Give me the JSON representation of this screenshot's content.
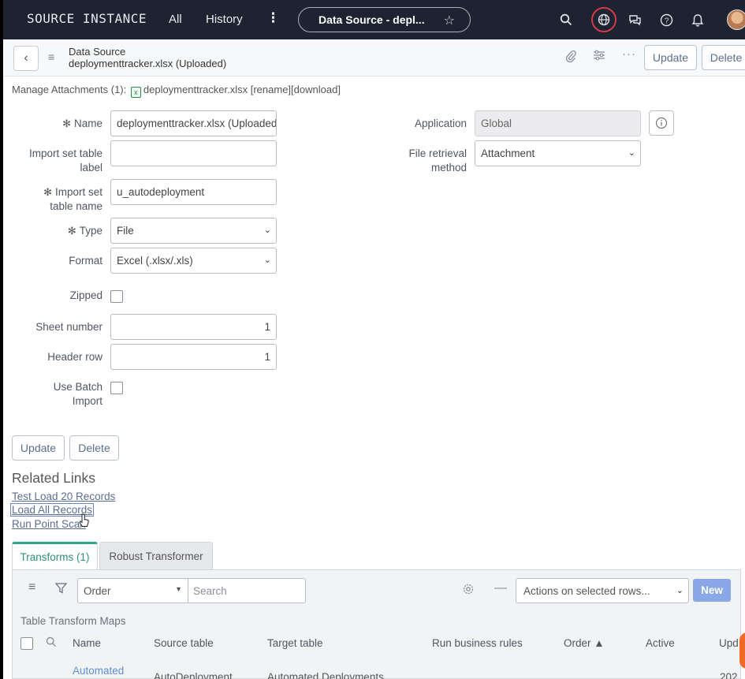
{
  "topnav": {
    "brand": "SOURCE INSTANCE",
    "all": "All",
    "history": "History",
    "more": "⋮",
    "context_title": "Data Source - depl...",
    "icons": [
      "search-icon",
      "globe-icon",
      "chat-icon",
      "help-icon",
      "bell-icon",
      "avatar"
    ]
  },
  "header": {
    "title_line1": "Data Source",
    "title_line2": "deploymenttracker.xlsx (Uploaded)",
    "update_label": "Update",
    "delete_label": "Delete"
  },
  "attachments": {
    "prefix": "Manage Attachments (1):",
    "filename": "deploymenttracker.xlsx",
    "rename": "[rename]",
    "download": "[download]"
  },
  "form": {
    "name_label": "Name",
    "name_value": "deploymenttracker.xlsx (Uploaded)",
    "import_label_line1": "Import set table",
    "import_label_line2": "label",
    "import_label_value": "",
    "import_name_line1": "Import set",
    "import_name_line2": "table name",
    "import_name_value": "u_autodeployment",
    "type_label": "Type",
    "type_value": "File",
    "format_label": "Format",
    "format_value": "Excel (.xlsx/.xls)",
    "zipped_label": "Zipped",
    "sheet_label": "Sheet number",
    "sheet_value": "1",
    "header_row_label": "Header row",
    "header_row_value": "1",
    "batch_line1": "Use Batch",
    "batch_line2": "Import",
    "application_label": "Application",
    "application_value": "Global",
    "retrieval_line1": "File retrieval",
    "retrieval_line2": "method",
    "retrieval_value": "Attachment"
  },
  "bottom_buttons": {
    "update": "Update",
    "delete": "Delete"
  },
  "related_links": {
    "title": "Related Links",
    "links": [
      "Test Load 20 Records",
      "Load All Records",
      "Run Point Scan"
    ]
  },
  "tabs": [
    {
      "label": "Transforms (1)",
      "active": true
    },
    {
      "label": "Robust Transformer",
      "active": false
    }
  ],
  "list": {
    "order_select": "Order",
    "search_placeholder": "Search",
    "actions_select": "Actions on selected rows...",
    "new_label": "New",
    "caption": "Table Transform Maps",
    "columns": [
      "Name",
      "Source table",
      "Target table",
      "Run business rules",
      "Order ▲",
      "Active",
      "Upd"
    ],
    "row": {
      "name": "Automated",
      "source": "AutoDeployment",
      "target": "Automated Deployments",
      "updated": "202"
    }
  },
  "colors": {
    "nav_bg": "#1d2330",
    "accent": "#2fa58c",
    "link": "#5b6e8f",
    "new_button": "#8aa7e8",
    "globe_ring": "#d23a4a"
  }
}
